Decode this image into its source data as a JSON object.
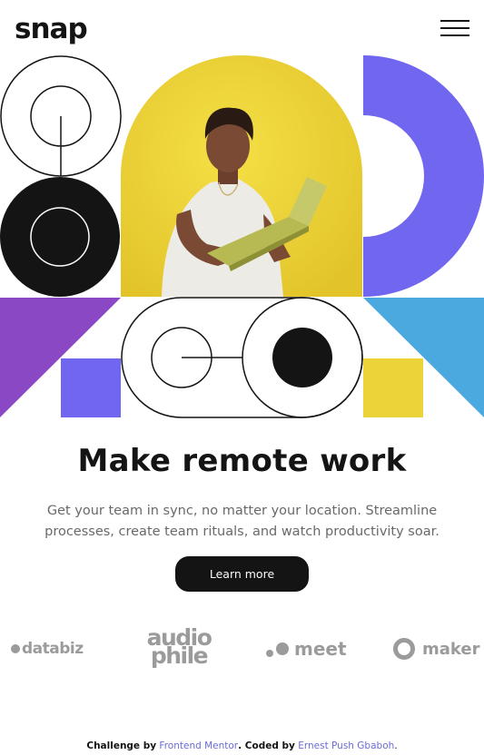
{
  "header": {
    "logo": "snap",
    "menu_icon": "hamburger-menu-icon"
  },
  "hero": {
    "image_alt": "person holding a laptop",
    "colors": {
      "yellow": "#EDD33A",
      "purple": "#7166EF",
      "violet": "#8A48C5",
      "blue": "#4CA9E0",
      "black": "#141414"
    }
  },
  "main": {
    "headline": "Make remote work",
    "description": "Get your team in sync, no matter your location. Streamline processes, create team rituals, and watch productivity soar.",
    "cta_label": "Learn more"
  },
  "clients": {
    "databiz": "databiz",
    "audiophile_line1": "audio",
    "audiophile_line2": "phile",
    "meet": "meet",
    "maker": "maker"
  },
  "footer": {
    "challenge_prefix": "Challenge by",
    "challenge_link": "Frontend Mentor",
    "coded_prefix": ". Coded by",
    "author_link": "Ernest Push Gbaboh",
    "suffix": "."
  }
}
